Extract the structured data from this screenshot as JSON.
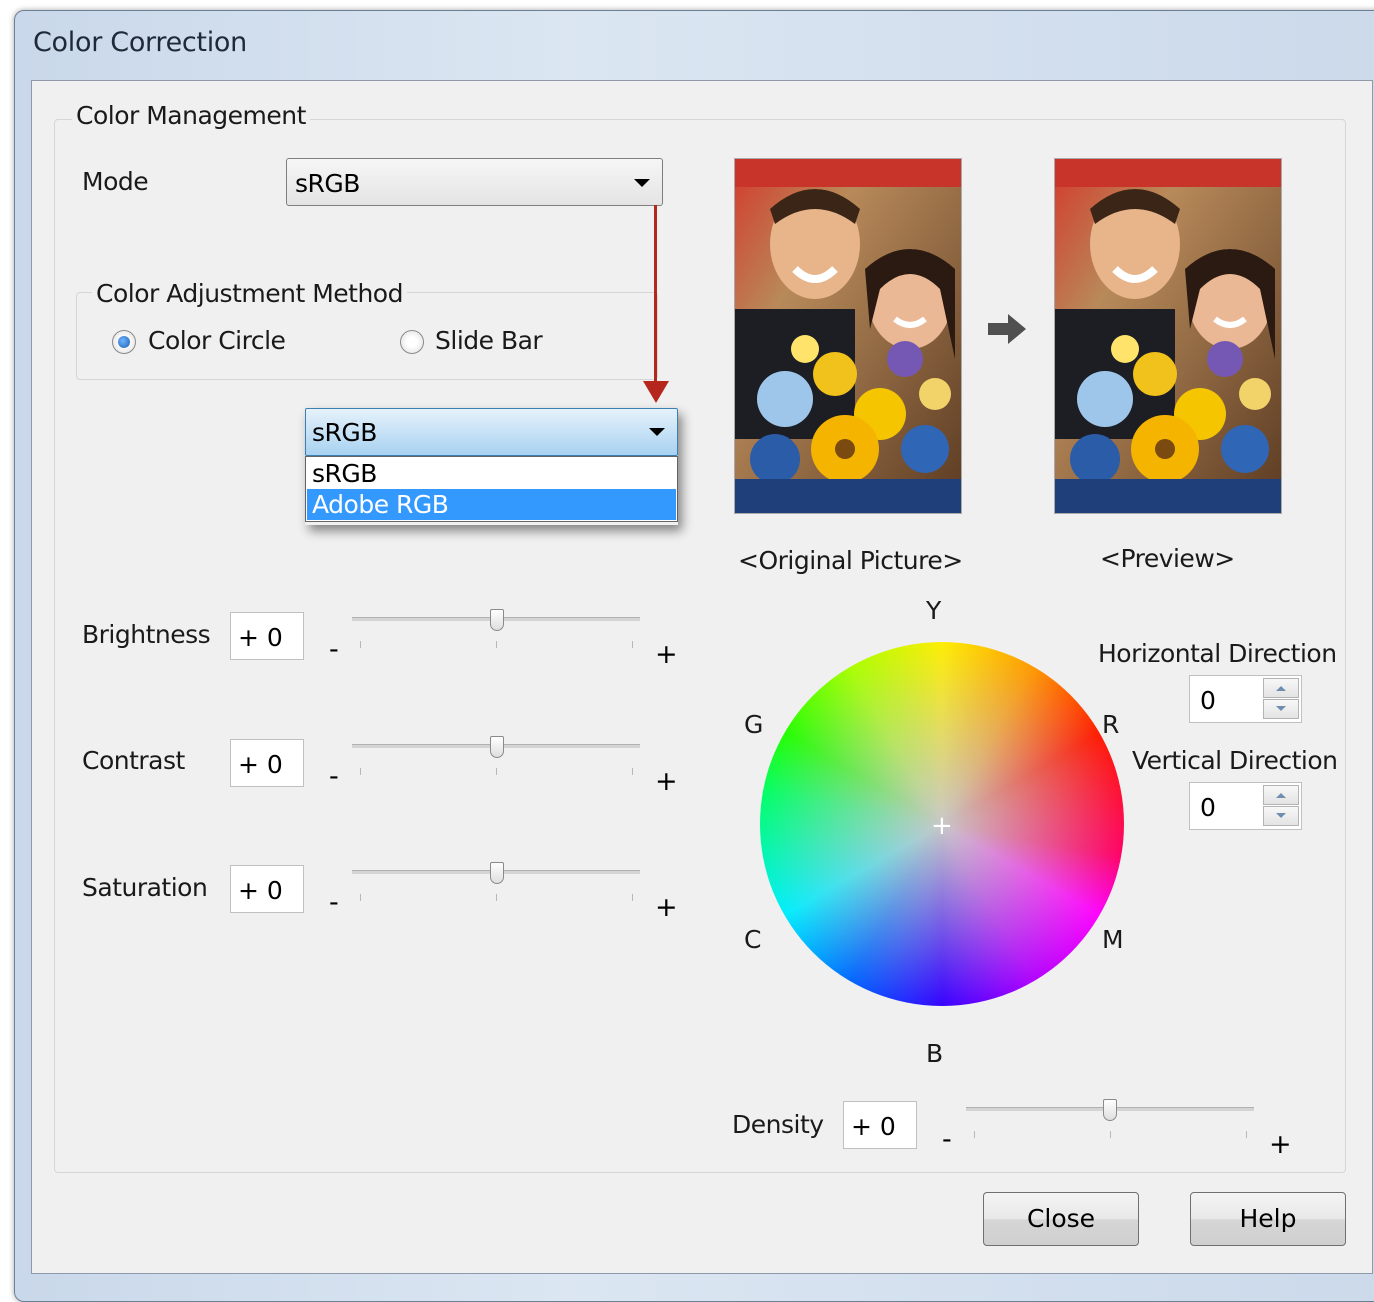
{
  "window": {
    "title": "Color Correction"
  },
  "color_management": {
    "legend": "Color Management",
    "mode_label": "Mode",
    "mode_value": "sRGB",
    "adjust_method": {
      "legend": "Color Adjustment Method",
      "options": [
        "Color Circle",
        "Slide Bar"
      ],
      "selected": "Color Circle"
    },
    "dropdown_callout": {
      "value": "sRGB",
      "options": [
        "sRGB",
        "Adobe RGB"
      ],
      "highlighted": "Adobe RGB"
    },
    "sliders": [
      {
        "label": "Brightness",
        "value": "+ 0",
        "minus": "-",
        "plus": "+"
      },
      {
        "label": "Contrast",
        "value": "+ 0",
        "minus": "-",
        "plus": "+"
      },
      {
        "label": "Saturation",
        "value": "+ 0",
        "minus": "-",
        "plus": "+"
      }
    ],
    "original_caption": "<Original Picture>",
    "preview_caption": "<Preview>",
    "color_circle": {
      "labels": {
        "top": "Y",
        "upper_left": "G",
        "upper_right": "R",
        "lower_left": "C",
        "lower_right": "M",
        "bottom": "B"
      }
    },
    "horizontal_direction": {
      "label": "Horizontal Direction",
      "value": "0"
    },
    "vertical_direction": {
      "label": "Vertical Direction",
      "value": "0"
    },
    "density": {
      "label": "Density",
      "value": "+ 0",
      "minus": "-",
      "plus": "+"
    }
  },
  "buttons": {
    "close": "Close",
    "help": "Help"
  },
  "colors": {
    "callout_arrow": "#b5271c",
    "highlight": "#3399ff"
  }
}
